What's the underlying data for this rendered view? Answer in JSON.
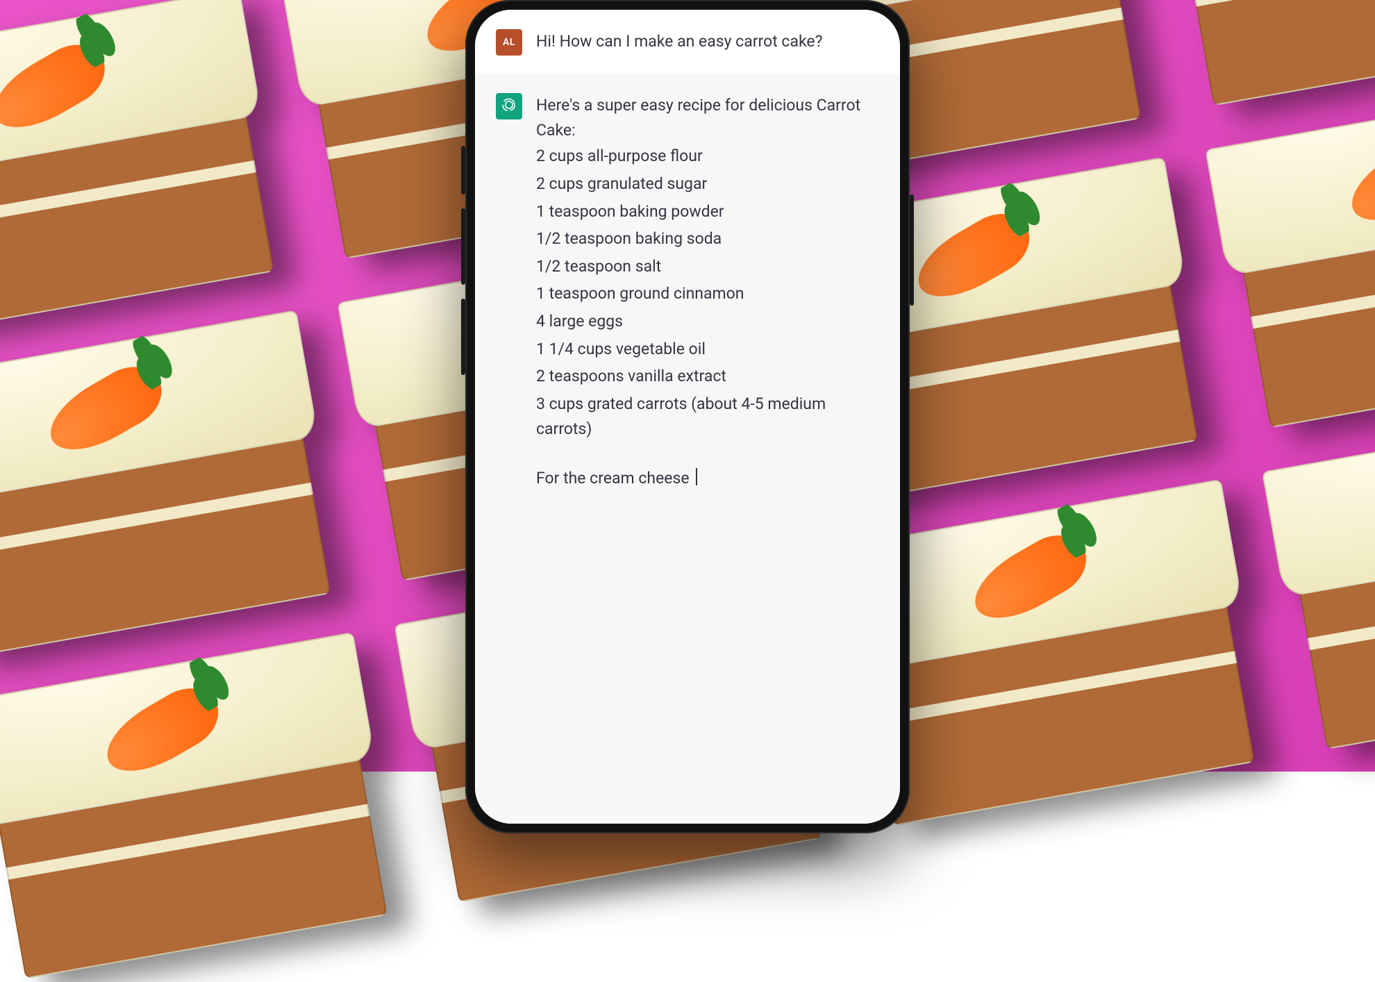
{
  "colors": {
    "background_pink": "#e14bbf",
    "assistant_accent": "#10a37f",
    "user_avatar": "#b5502b",
    "text": "#343541"
  },
  "chat": {
    "user": {
      "avatar_initials": "AL",
      "text": "Hi! How can I make an easy carrot cake?"
    },
    "assistant": {
      "intro": "Here's a super easy recipe for delicious Carrot Cake:",
      "ingredients": [
        "2 cups all-purpose flour",
        "2 cups granulated sugar",
        "1 teaspoon baking powder",
        "1/2 teaspoon baking soda",
        "1/2 teaspoon salt",
        "1 teaspoon ground cinnamon",
        "4 large eggs",
        "1 1/4 cups vegetable oil",
        "2 teaspoons vanilla extract",
        "3 cups grated carrots (about 4-5 medium carrots)"
      ],
      "continuation": "For the cream cheese "
    }
  }
}
